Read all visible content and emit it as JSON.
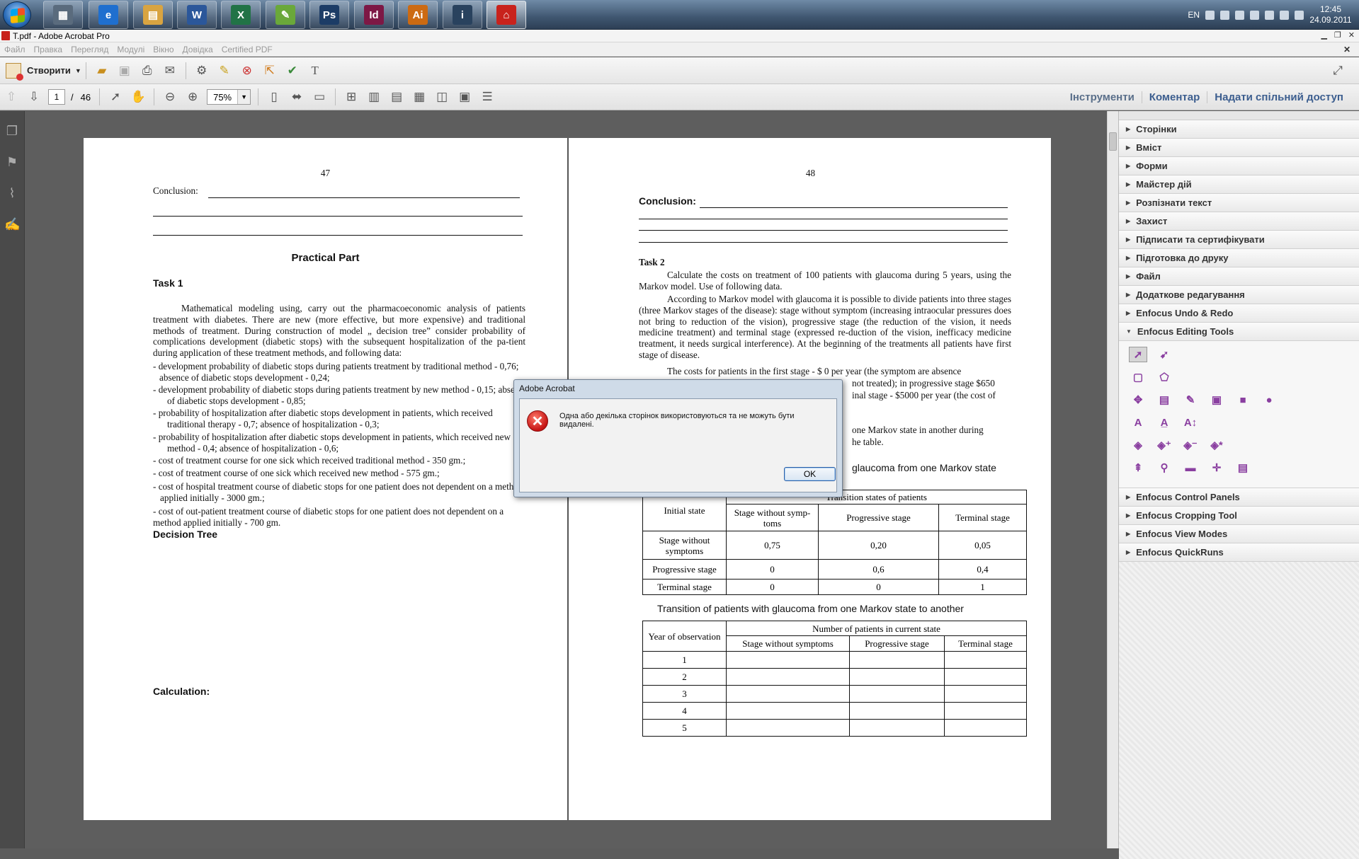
{
  "taskbar": {
    "apps": [
      {
        "name": "calculator",
        "label": "▦",
        "color": "#5a6b7d"
      },
      {
        "name": "internet-explorer",
        "label": "e",
        "color": "#1f6fcf"
      },
      {
        "name": "file-explorer",
        "label": "▤",
        "color": "#d9a441"
      },
      {
        "name": "word",
        "label": "W",
        "color": "#2b579a"
      },
      {
        "name": "excel",
        "label": "X",
        "color": "#217346"
      },
      {
        "name": "app-green",
        "label": "✎",
        "color": "#6aa83a"
      },
      {
        "name": "photoshop",
        "label": "Ps",
        "color": "#1c3c66"
      },
      {
        "name": "indesign",
        "label": "Id",
        "color": "#7d1845"
      },
      {
        "name": "illustrator",
        "label": "Ai",
        "color": "#cc6a12"
      },
      {
        "name": "presentation",
        "label": "i",
        "color": "#29425e"
      },
      {
        "name": "acrobat",
        "label": "⌂",
        "color": "#c8221c"
      }
    ],
    "lang": "EN",
    "time": "12:45",
    "date": "24.09.2011"
  },
  "window": {
    "title": "T.pdf - Adobe Acrobat Pro"
  },
  "menu": [
    "Файл",
    "Правка",
    "Перегляд",
    "Модулі",
    "Вікно",
    "Довідка",
    "Certified PDF"
  ],
  "toolbar": {
    "create_label": "Створити",
    "page_current": "1",
    "page_sep": "/",
    "page_total": "46",
    "zoom": "75%"
  },
  "right_links": [
    "Інструменти",
    "Коментар",
    "Надати спільний доступ"
  ],
  "page_left": {
    "page_number": "47",
    "conclusion": "Conclusion:",
    "heading": "Practical Part",
    "task": "Task 1",
    "para": "Mathematical modeling using, carry out the pharmacoeconomic analysis of patients treatment with diabetes. There are new (more effective, but more expensive) and traditional methods of treatment. During construction of model „ decision tree” consider probability of complications development (diabetic stops) with the subsequent hospitalization of the pa-tient during application of these treatment methods, and following data:",
    "items": [
      "- development probability of diabetic stops during patients treatment by traditional method - 0,76; absence of diabetic stops development - 0,24;",
      "- development probability of diabetic stops during patients treatment by new method - 0,15; absence of diabetic stops development - 0,85;",
      "- probability of hospitalization after diabetic stops development in patients, which received traditional therapy - 0,7; absence of hospitalization - 0,3;",
      "- probability of hospitalization after diabetic stops development in patients, which received new method - 0,4; absence of hospitalization - 0,6;",
      "- cost of treatment course for one sick which received traditional method - 350 gm.;",
      "- cost of treatment course of one sick which received new method - 575 gm.;",
      "- cost of hospital treatment course of diabetic stops for one patient does not dependent on a method applied initially - 3000 gm.;",
      "- cost of out-patient treatment course of diabetic stops for one patient does not dependent on a method applied initially - 700 gm."
    ],
    "decision_tree": "Decision Tree",
    "calculation": "Calculation:"
  },
  "page_right": {
    "page_number": "48",
    "conclusion": "Conclusion:",
    "task": "Task 2",
    "p1": "Calculate the costs on treatment of 100 patients with glaucoma during 5 years, using the Markov model. Use of following data.",
    "p2": "According to Markov model with glaucoma it is possible to divide patients into three stages (three Markov stages of the disease): stage without symptom (increasing intraocular pressures does not bring to reduction of the vision), progressive stage (the reduction of the vision, it needs medicine treatment) and terminal stage (expressed re-duction of the vision, inefficacy medicine treatment, it needs surgical interference). At the beginning of the treatments all patients have first stage of disease.",
    "p3a": "The costs for patients in the first stage - $ 0 per year (the symptom  are absence",
    "p3b": "not treated); in progressive stage $650",
    "p3c": "inal stage - $5000 per year (the cost of",
    "p4a": "one Markov state in another during",
    "p4b": "he table.",
    "caption1": "glaucoma from one Markov state",
    "table1": {
      "head_initial": "Initial state",
      "head_transition": "Transition states of patients",
      "cols": [
        "Stage without symp-toms",
        "Progressive stage",
        "Terminal stage"
      ],
      "rows": [
        {
          "label": "Stage without symptoms",
          "vals": [
            "0,75",
            "0,20",
            "0,05"
          ]
        },
        {
          "label": "Progressive stage",
          "vals": [
            "0",
            "0,6",
            "0,4"
          ]
        },
        {
          "label": "Terminal stage",
          "vals": [
            "0",
            "0",
            "1"
          ]
        }
      ]
    },
    "caption2": "Transition of patients with glaucoma from one Markov state to another",
    "table2": {
      "head_year": "Year of observation",
      "head_number": "Number of patients in current state",
      "cols": [
        "Stage without symptoms",
        "Progressive stage",
        "Terminal stage"
      ],
      "years": [
        "1",
        "2",
        "3",
        "4",
        "5"
      ]
    }
  },
  "right_panel": {
    "sections_top": [
      "Сторінки",
      "Вміст",
      "Форми",
      "Майстер дій",
      "Розпізнати текст",
      "Захист",
      "Підписати та сертифікувати",
      "Підготовка до друку",
      "Файл",
      "Додаткове редагування",
      "Enfocus Undo & Redo",
      "Enfocus Editing Tools"
    ],
    "sections_bottom": [
      "Enfocus Control Panels",
      "Enfocus Cropping Tool",
      "Enfocus View Modes",
      "Enfocus QuickRuns"
    ]
  },
  "dialog": {
    "title": "Adobe Acrobat",
    "message": "Одна або декілька сторінок використовуються та не можуть бути видалені.",
    "ok": "OK"
  }
}
